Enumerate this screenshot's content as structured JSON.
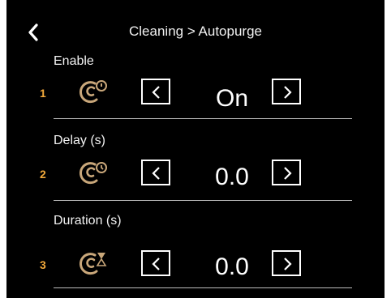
{
  "header": {
    "title": "Cleaning > Autopurge"
  },
  "colors": {
    "accent": "#f2a93b",
    "icon_stroke": "#c9a77a",
    "background": "#000000"
  },
  "rows": [
    {
      "number": "1",
      "label": "Enable",
      "value": "On",
      "icon": "autopurge-enable-icon"
    },
    {
      "number": "2",
      "label": "Delay (s)",
      "value": "0.0",
      "icon": "autopurge-delay-icon"
    },
    {
      "number": "3",
      "label": "Duration (s)",
      "value": "0.0",
      "icon": "autopurge-duration-icon"
    }
  ]
}
